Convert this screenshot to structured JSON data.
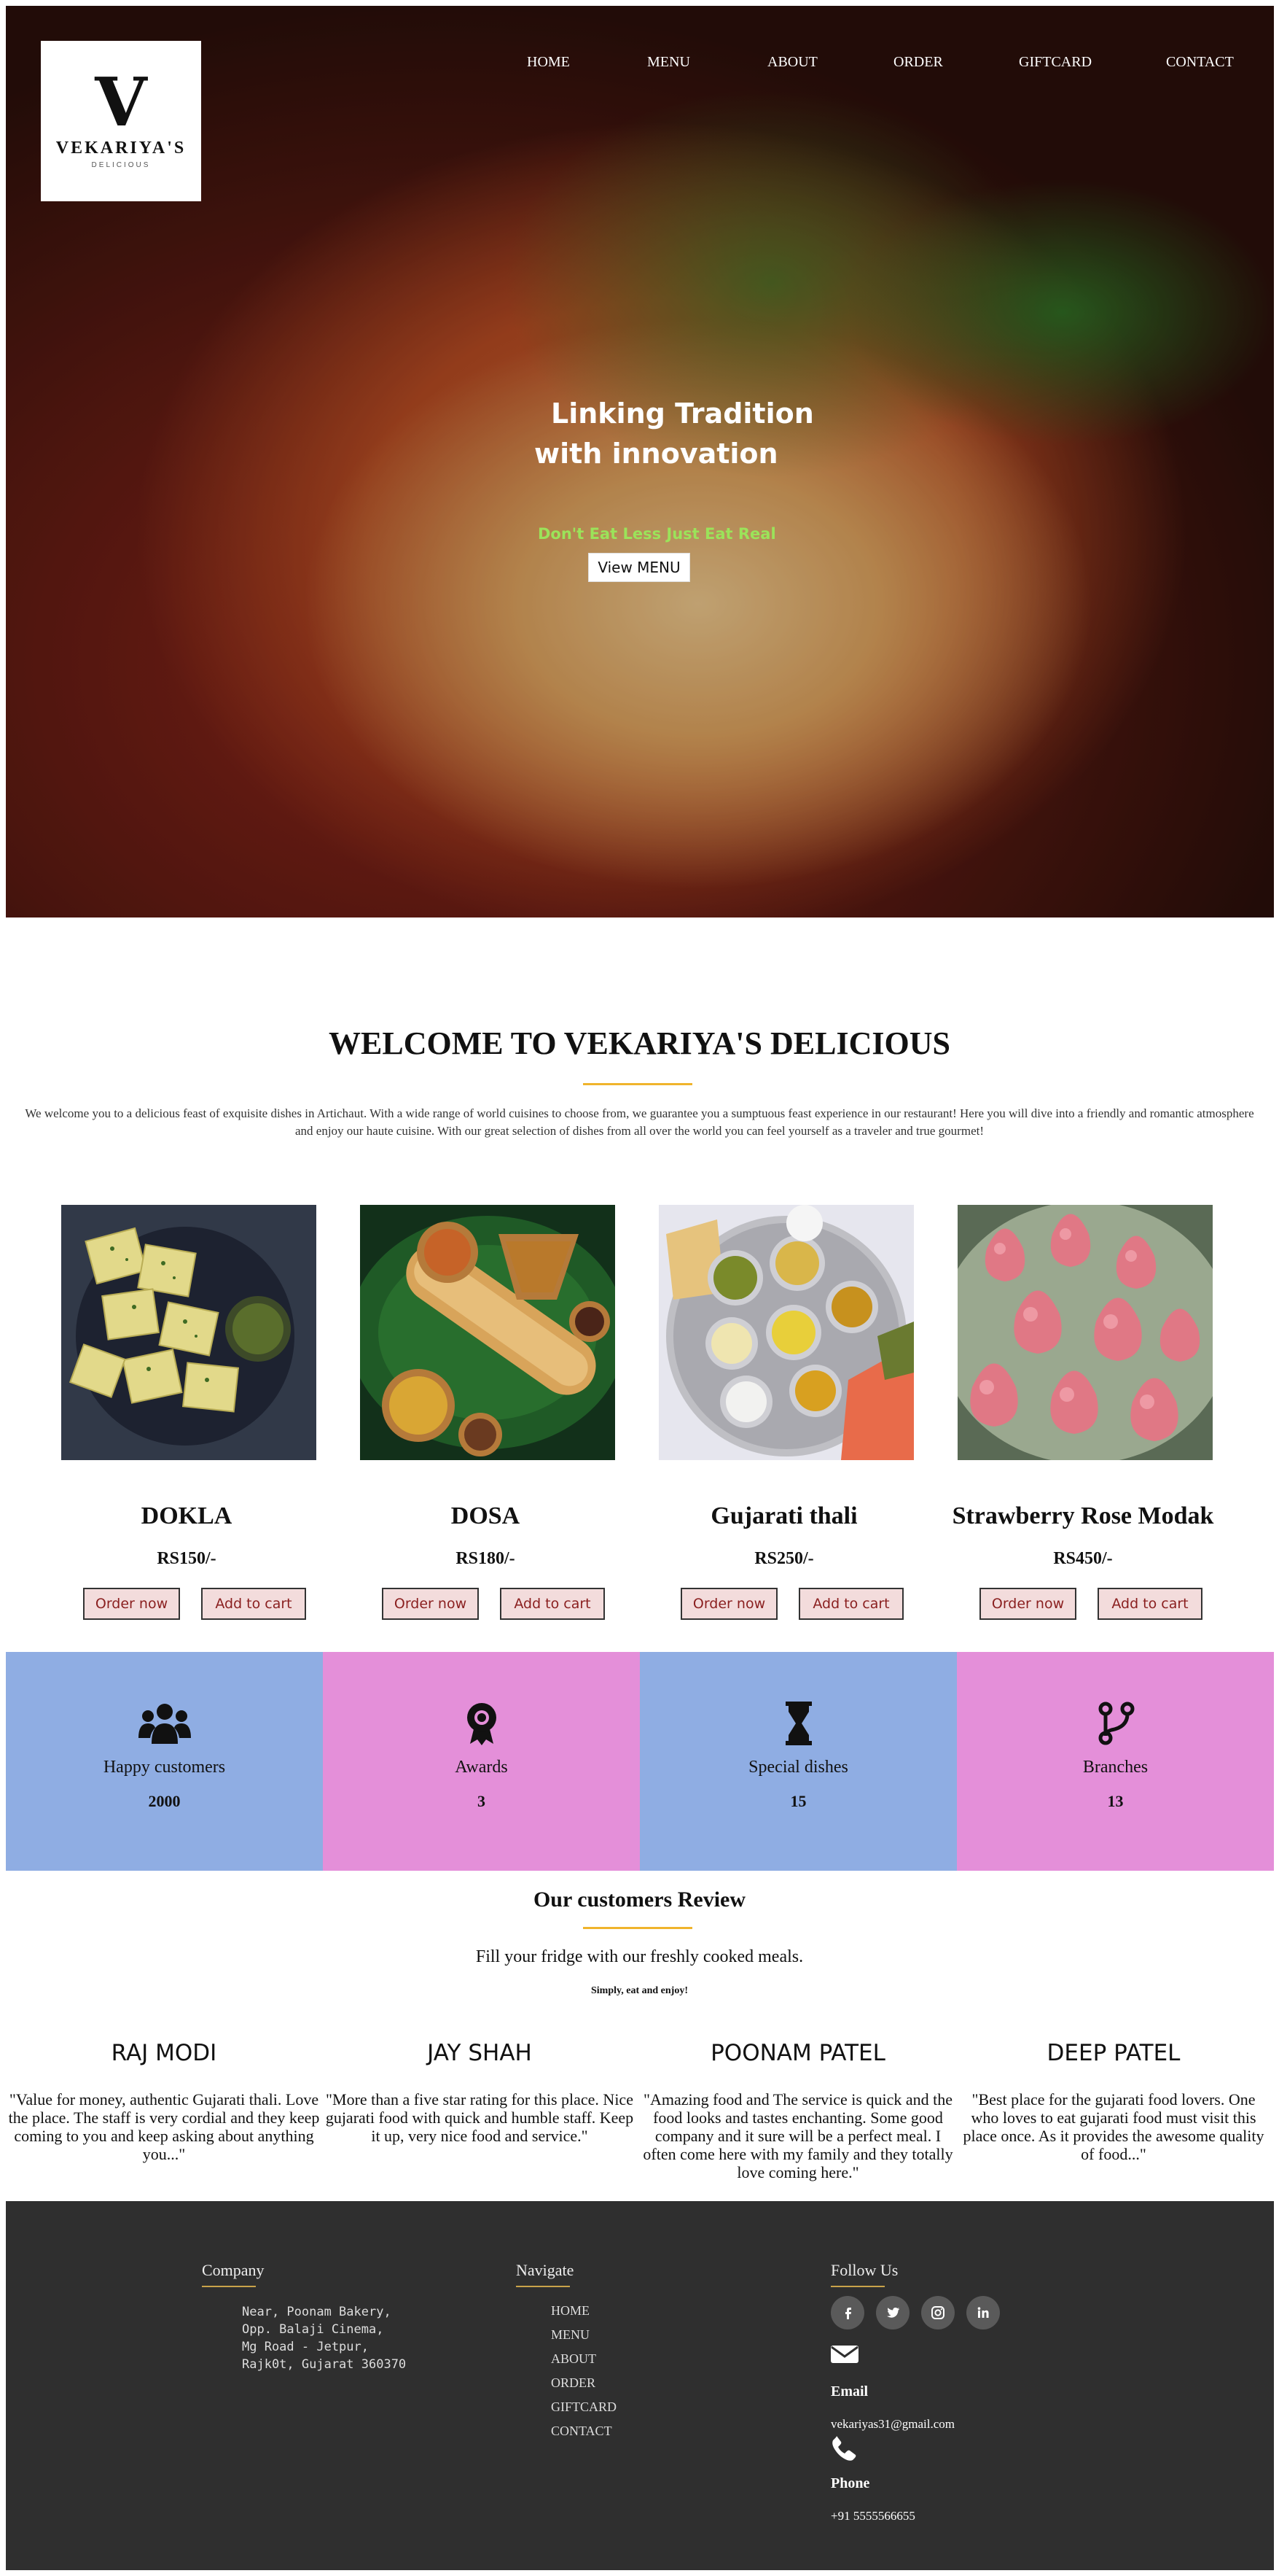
{
  "logo": {
    "mark": "V",
    "name": "VEKARIYA'S",
    "sub": "DELICIOUS"
  },
  "nav": [
    "HOME",
    "MENU",
    "ABOUT",
    "ORDER",
    "GIFTCARD",
    "CONTACT"
  ],
  "hero": {
    "line1": "Linking Tradition",
    "line2": "with innovation",
    "tagline": "Don't Eat Less Just Eat Real",
    "button": "View MENU"
  },
  "welcome": {
    "title": "WELCOME TO VEKARIYA'S DELICIOUS",
    "text": "We welcome you to a delicious feast of exquisite dishes in Artichaut. With a wide range of world cuisines to choose from, we guarantee you a sumptuous feast experience in our restaurant! Here you will dive into a friendly and romantic atmosphere and enjoy our haute cuisine. With our great selection of dishes from all over the world you can feel yourself as a traveler and true gourmet!"
  },
  "dishes": [
    {
      "name": "DOKLA",
      "price": "RS150/-",
      "order": "Order now",
      "cart": "Add to cart"
    },
    {
      "name": "DOSA",
      "price": "RS180/-",
      "order": "Order now",
      "cart": "Add to cart"
    },
    {
      "name": "Gujarati thali",
      "price": "RS250/-",
      "order": "Order now",
      "cart": "Add to cart"
    },
    {
      "name": "Strawberry Rose Modak",
      "price": "RS450/-",
      "order": "Order now",
      "cart": "Add to cart"
    }
  ],
  "stats": [
    {
      "label": "Happy customers",
      "value": "2000",
      "icon": "users-icon",
      "color": "#8fade3"
    },
    {
      "label": "Awards",
      "value": "3",
      "icon": "award-icon",
      "color": "#e48fd9"
    },
    {
      "label": "Special dishes",
      "value": "15",
      "icon": "hourglass-icon",
      "color": "#8fade3"
    },
    {
      "label": "Branches",
      "value": "13",
      "icon": "code-branch-icon",
      "color": "#e48fd9"
    }
  ],
  "reviews": {
    "title": "Our customers Review",
    "subtitle": "Fill your fridge with our freshly cooked meals.",
    "tagline": "Simply, eat and enjoy!",
    "items": [
      {
        "name": "RAJ MODI",
        "quote": "\"Value for money, authentic Gujarati thali. Love the place. The staff is very cordial and they keep coming to you and keep asking about anything you...\""
      },
      {
        "name": "JAY SHAH",
        "quote": "\"More than a five star rating for this place. Nice gujarati food with quick and humble staff. Keep it up, very nice food and service.\""
      },
      {
        "name": "POONAM PATEL",
        "quote": "\"Amazing food and The service is quick and the food looks and tastes enchanting. Some good company and it sure will be a perfect meal. I often come here with my family and they totally love coming here.\""
      },
      {
        "name": "DEEP PATEL",
        "quote": "\"Best place for the gujarati food lovers. One who loves to eat gujarati food must visit this place once. As it provides the awesome quality of food...\""
      }
    ]
  },
  "footer": {
    "company_title": "Company",
    "address": "Near, Poonam Bakery,\nOpp. Balaji Cinema,\nMg Road - Jetpur,\nRajk0t, Gujarat 360370",
    "navigate_title": "Navigate",
    "links": [
      "HOME",
      "MENU",
      "ABOUT",
      "ORDER",
      "GIFTCARD",
      "CONTACT"
    ],
    "follow_title": "Follow Us",
    "social": [
      "facebook-icon",
      "twitter-icon",
      "instagram-icon",
      "linkedin-icon"
    ],
    "email_label": "Email",
    "email": "vekariyas31@gmail.com",
    "phone_label": "Phone",
    "phone": "+91 5555566655"
  },
  "colors": {
    "accent_gold": "#f0b42c",
    "stat_blue": "#8fade3",
    "stat_pink": "#e48fd9",
    "footer_bg": "#2f2f2f",
    "tagline_green": "#9be35a"
  }
}
